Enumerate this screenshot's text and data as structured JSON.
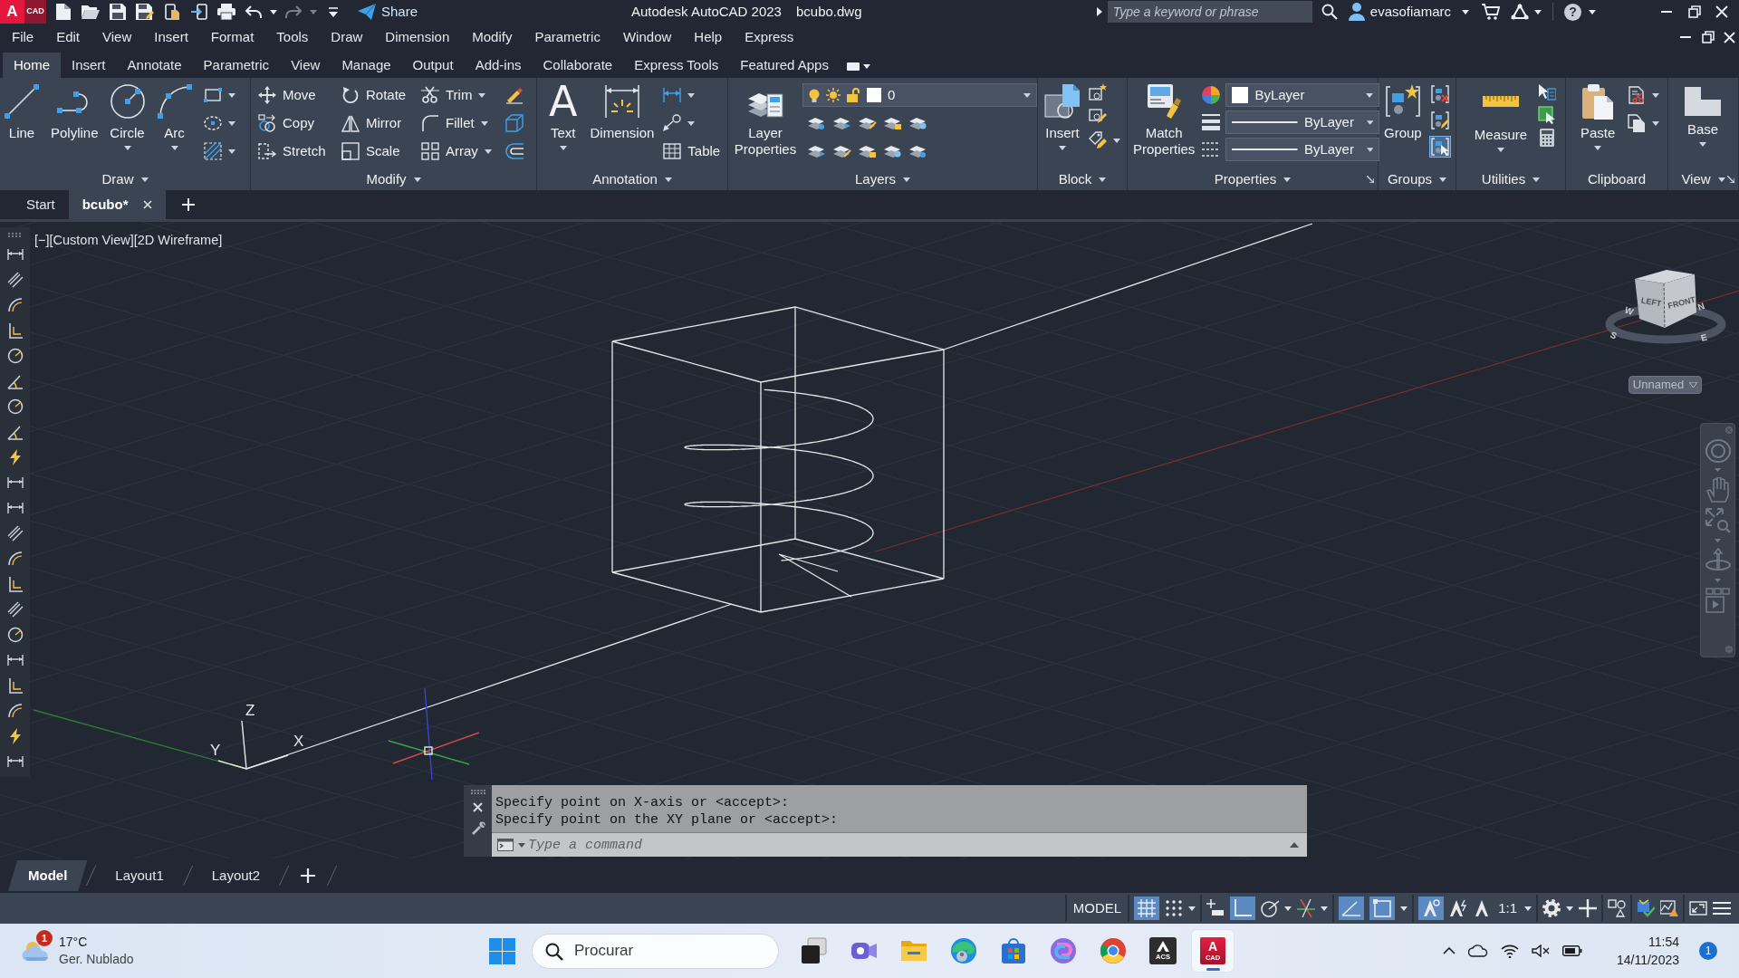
{
  "title_bar": {
    "logo": {
      "letter": "A",
      "label": "CAD"
    },
    "redo": {
      "disabled": true
    },
    "share": "Share",
    "app_title": "Autodesk AutoCAD 2023",
    "file_name": "bcubo.dwg",
    "search": {
      "placeholder": "Type a keyword or phrase"
    },
    "user": "evasofiamarc",
    "help": "?"
  },
  "menu_bar": [
    "File",
    "Edit",
    "View",
    "Insert",
    "Format",
    "Tools",
    "Draw",
    "Dimension",
    "Modify",
    "Parametric",
    "Window",
    "Help",
    "Express"
  ],
  "ribbon": {
    "tabs": [
      {
        "label": "Home",
        "selected": true
      },
      {
        "label": "Insert",
        "selected": false
      },
      {
        "label": "Annotate",
        "selected": false
      },
      {
        "label": "Parametric",
        "selected": false
      },
      {
        "label": "View",
        "selected": false
      },
      {
        "label": "Manage",
        "selected": false
      },
      {
        "label": "Output",
        "selected": false
      },
      {
        "label": "Add-ins",
        "selected": false
      },
      {
        "label": "Collaborate",
        "selected": false
      },
      {
        "label": "Express Tools",
        "selected": false
      },
      {
        "label": "Featured Apps",
        "selected": false
      }
    ],
    "panels": [
      {
        "kind": "draw",
        "title": "Draw",
        "expandable": true,
        "buttons": [
          {
            "label": "Line",
            "dropdown": false
          },
          {
            "label": "Polyline",
            "dropdown": false
          },
          {
            "label": "Circle",
            "dropdown": true
          },
          {
            "label": "Arc",
            "dropdown": true
          }
        ]
      },
      {
        "kind": "modify",
        "title": "Modify",
        "expandable": true,
        "tools": [
          {
            "label": "Move",
            "dropdown": false
          },
          {
            "label": "Rotate",
            "dropdown": false
          },
          {
            "label": "Trim",
            "dropdown": true
          },
          {
            "label": "Copy",
            "dropdown": false
          },
          {
            "label": "Mirror",
            "dropdown": false
          },
          {
            "label": "Fillet",
            "dropdown": true
          },
          {
            "label": "Stretch",
            "dropdown": false
          },
          {
            "label": "Scale",
            "dropdown": false
          },
          {
            "label": "Array",
            "dropdown": true
          }
        ]
      },
      {
        "kind": "annotation",
        "title": "Annotation",
        "expandable": true,
        "buttons": [
          {
            "label": "Text",
            "glyph": "A",
            "dropdown": true
          },
          {
            "label": "Dimension",
            "dropdown": false
          }
        ],
        "tools": [
          {
            "label": "Table",
            "dropdown": false
          }
        ]
      },
      {
        "kind": "layers",
        "title": "Layers",
        "expandable": true,
        "buttons": [
          {
            "label": "Layer Properties",
            "dropdown": false
          }
        ],
        "current_layer": "0"
      },
      {
        "kind": "block",
        "title": "Block",
        "expandable": true,
        "buttons": [
          {
            "label": "Insert",
            "dropdown": true
          }
        ]
      },
      {
        "kind": "properties",
        "title": "Properties",
        "expandable": true,
        "launcher": true,
        "buttons": [
          {
            "label": "Match Properties",
            "dropdown": false
          }
        ],
        "dropdowns": [
          {
            "kind": "color",
            "value": "ByLayer"
          },
          {
            "kind": "lineweight",
            "value": "ByLayer"
          },
          {
            "kind": "linetype",
            "value": "ByLayer"
          }
        ]
      },
      {
        "kind": "groups",
        "title": "Groups",
        "expandable": true,
        "buttons": [
          {
            "label": "Group",
            "dropdown": false
          }
        ],
        "toggles": [
          {
            "kind": "ungroup",
            "on": false
          },
          {
            "kind": "edit",
            "on": false
          },
          {
            "kind": "select",
            "on": true
          }
        ]
      },
      {
        "kind": "utilities",
        "title": "Utilities",
        "expandable": true,
        "buttons": [
          {
            "label": "Measure",
            "dropdown": true
          }
        ]
      },
      {
        "kind": "clipboard",
        "title": "Clipboard",
        "expandable": false,
        "buttons": [
          {
            "label": "Paste",
            "dropdown": true
          }
        ]
      },
      {
        "kind": "view",
        "title": "View",
        "expandable": true,
        "launcher": true,
        "buttons": [
          {
            "label": "Base",
            "dropdown": true
          }
        ]
      }
    ]
  },
  "file_tabs": [
    {
      "label": "Start",
      "selected": false,
      "closable": false
    },
    {
      "label": "bcubo*",
      "selected": true,
      "closable": true
    }
  ],
  "viewport": {
    "controls": [
      "[−]",
      "[Custom View]",
      "[2D Wireframe]"
    ],
    "ucs_labels": {
      "z": "Z",
      "y": "Y",
      "x": "X"
    },
    "viewcube": {
      "faces": [
        "LEFT",
        "FRONT"
      ],
      "compass": {
        "west": "W",
        "north": "N",
        "south": "S",
        "east": "E"
      }
    },
    "named_view": "Unnamed"
  },
  "command_line": {
    "history": [
      "Specify point on X-axis or <accept>:",
      "Specify point on the XY plane or <accept>:"
    ],
    "input": {
      "placeholder": "Type a command"
    }
  },
  "layout_tabs": [
    {
      "label": "Model",
      "selected": true
    },
    {
      "label": "Layout1",
      "selected": false
    },
    {
      "label": "Layout2",
      "selected": false
    }
  ],
  "status_bar": {
    "groups": [
      [
        {
          "kind": "space",
          "text": "MODEL",
          "on": false,
          "dropdown": false
        }
      ],
      [
        {
          "kind": "grid",
          "on": true,
          "dropdown": false
        },
        {
          "kind": "snap",
          "on": false,
          "dropdown": true
        }
      ],
      [
        {
          "kind": "infer",
          "on": false,
          "dropdown": false
        },
        {
          "kind": "ortho",
          "on": true,
          "dropdown": false
        },
        {
          "kind": "polar",
          "on": false,
          "dropdown": true
        },
        {
          "kind": "track",
          "on": false,
          "dropdown": true
        }
      ],
      [
        {
          "kind": "isodraft",
          "on": true,
          "dropdown": false
        },
        {
          "kind": "osnap",
          "on": true,
          "dropdown": true
        }
      ],
      [
        {
          "kind": "annovisible",
          "on": true,
          "dropdown": false
        },
        {
          "kind": "autoscale",
          "on": false,
          "dropdown": false
        },
        {
          "kind": "annoscale",
          "on": false,
          "dropdown": false
        },
        {
          "kind": "scale",
          "text": "1:1",
          "on": false,
          "dropdown": true
        }
      ],
      [
        {
          "kind": "workspace",
          "on": false,
          "dropdown": true
        },
        {
          "kind": "plus",
          "on": false,
          "dropdown": false
        }
      ],
      [
        {
          "kind": "isolate",
          "on": false,
          "dropdown": false
        }
      ],
      [
        {
          "kind": "hardware",
          "on": false,
          "dropdown": false
        },
        {
          "kind": "performance",
          "on": false,
          "dropdown": false
        }
      ],
      [
        {
          "kind": "fullscreen",
          "on": false,
          "dropdown": false
        },
        {
          "kind": "customize",
          "on": false,
          "dropdown": false
        }
      ]
    ]
  },
  "taskbar": {
    "weather": {
      "alerts": "1",
      "temperature": "17°C",
      "condition": "Ger. Nublado"
    },
    "search": {
      "placeholder": "Procurar"
    },
    "apps": [
      {
        "kind": "taskview",
        "selected": false
      },
      {
        "kind": "chat",
        "selected": false
      },
      {
        "kind": "folder",
        "selected": false
      },
      {
        "kind": "wave",
        "selected": false
      },
      {
        "kind": "bag",
        "selected": false
      },
      {
        "kind": "swirl",
        "selected": false
      },
      {
        "kind": "wheel",
        "selected": false
      },
      {
        "kind": "acs",
        "label": "ACS",
        "selected": false
      },
      {
        "kind": "autocad",
        "letter": "A",
        "label": "CAD",
        "selected": true
      }
    ],
    "clock": {
      "time": "11:54",
      "date": "14/11/2023"
    },
    "notifications": "1"
  }
}
